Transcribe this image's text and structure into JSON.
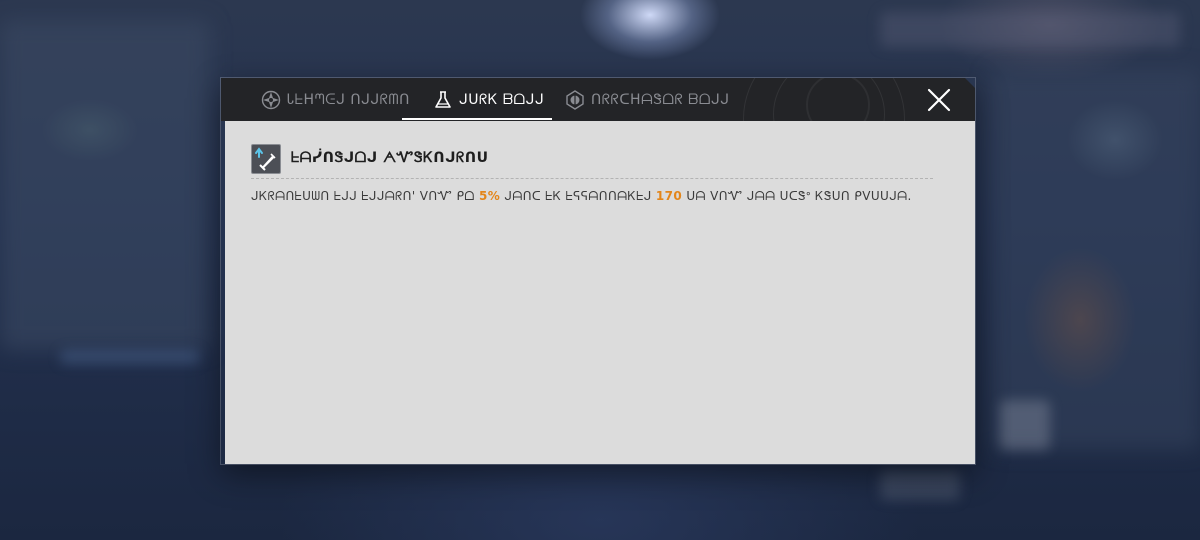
{
  "tabs": [
    {
      "label": "Ꮣᖶᕼᘉᕮᒍ ᑎᒍᒍᖇᗰᑎ",
      "icon": "compass-star-icon",
      "active": false
    },
    {
      "label": "ᒍᑌᖇᏦ ᗷᗝᒍᒍ",
      "icon": "flask-icon",
      "active": true
    },
    {
      "label": "ᑎᖇᖇᑕᕼᗩᏕᗝᖇ ᗷᗝᒍᒍ",
      "icon": "orb-emblem-icon",
      "active": false
    }
  ],
  "close_icon": "close-icon",
  "section": {
    "icon": "upgrade-sword-icon",
    "title": "ᖶᗩᓰᑎᏕᒍᗝᒍ ᗅᏉᏕᏦᑎᒍᖇᑎᑌ"
  },
  "description": {
    "part1": "ᒍᏦᖇᗩᑎᖶᑌᗯᑎ ᖶᒍᒍ ᖶᒍᒍᗩᖇᑎ' ᐯᑎᏉ ᑭᗝ ",
    "value1": "5%",
    "part2": " ᒍᗩᑎᑕ ᖶᏦ ᖶᕋᕋᗩᑎᑎᗩᏦᖶᒍ ",
    "value2": "170",
    "part3": " ᑌᗩ ᐯᑎᏉ ᒍᗩᗩ ᑌᑕᏕᐤ ᏦᏕᑌᑎ ᑭᐯᑌᑌᒍᗩ."
  },
  "colors": {
    "highlight": "#e3861b",
    "tabbar": "#232427",
    "panel": "#dcdcdc"
  }
}
